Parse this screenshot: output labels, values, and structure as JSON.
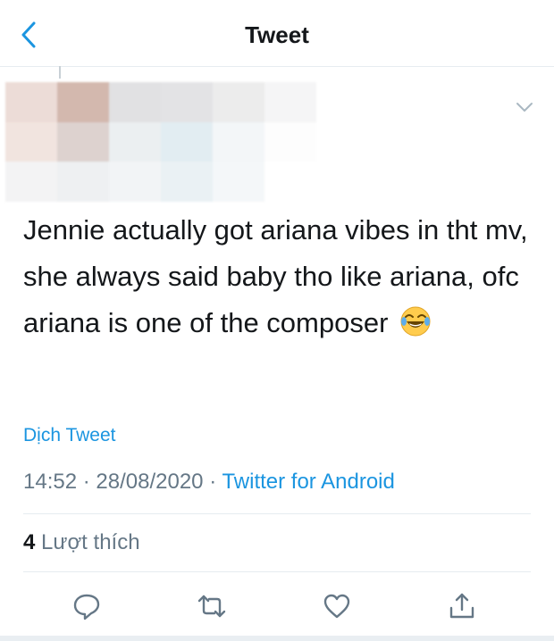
{
  "header": {
    "title": "Tweet",
    "back_icon": "chevron-left-icon"
  },
  "tweet": {
    "text": "Jennie actually got ariana vibes in tht mv, she always said baby tho like ariana, ofc ariana is one of the composer",
    "emoji": "face-with-tears-of-joy",
    "translate_label": "Dịch Tweet",
    "time": "14:52",
    "date": "28/08/2020",
    "separator": "·",
    "source": "Twitter for Android",
    "likes_count": "4",
    "likes_label": "Lượt thích"
  },
  "actions": [
    "reply-icon",
    "retweet-icon",
    "like-icon",
    "share-icon"
  ],
  "colors": {
    "accent": "#1b95e0",
    "secondary_text": "#657786",
    "divider": "#e6ecf0"
  }
}
